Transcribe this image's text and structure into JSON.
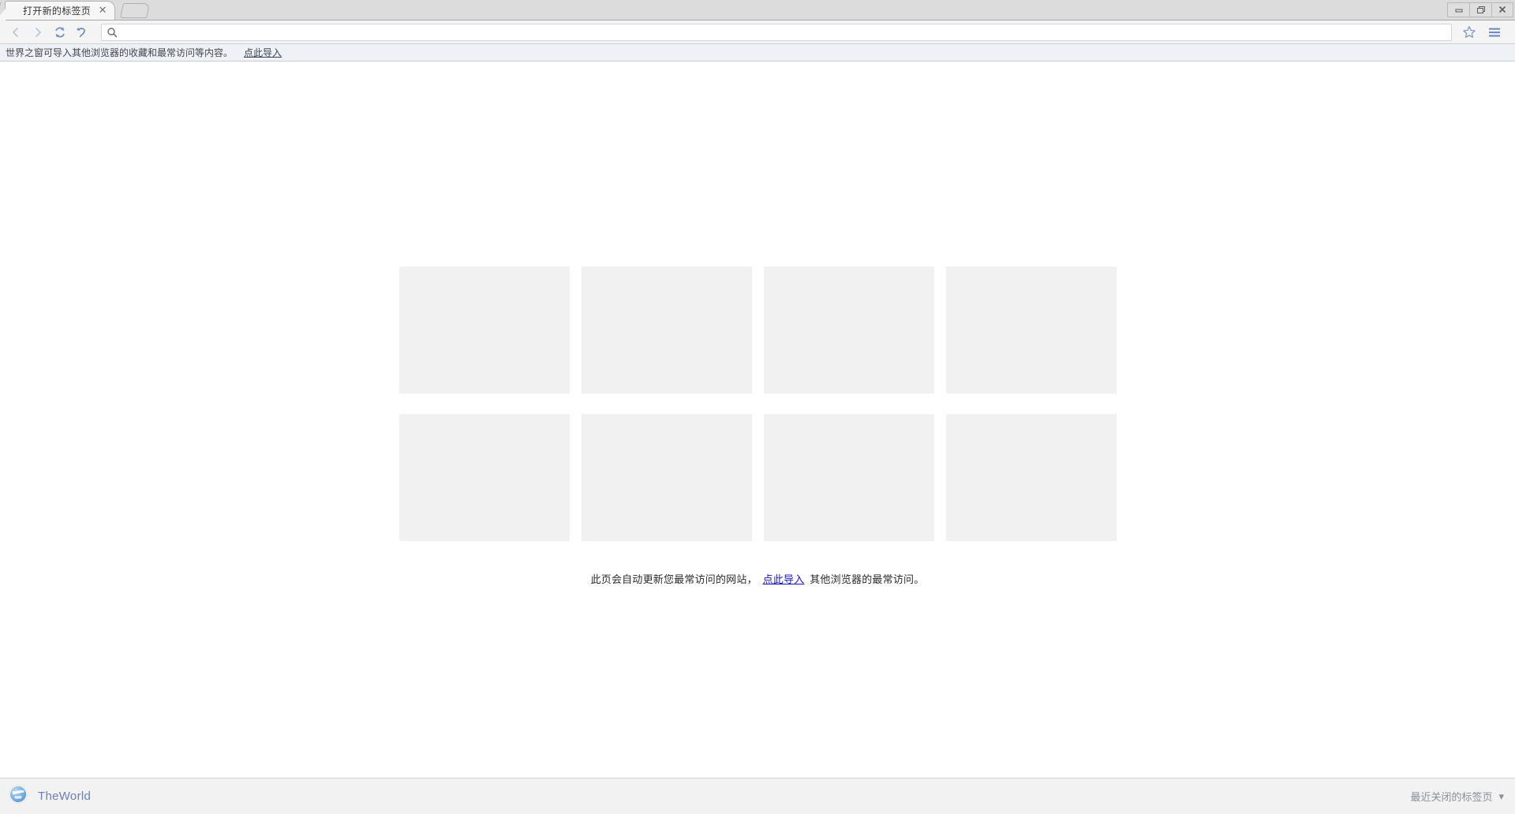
{
  "window": {
    "controls": [
      {
        "name": "minimize-button",
        "icon": "minimize-icon"
      },
      {
        "name": "restore-button",
        "icon": "restore-icon"
      },
      {
        "name": "close-button",
        "icon": "close-icon"
      }
    ]
  },
  "tabstrip": {
    "tabs": [
      {
        "title": "打开新的标签页",
        "close_label": "✕"
      }
    ],
    "new_tab_tooltip": "新建标签页"
  },
  "toolbar": {
    "back_label": "后退",
    "forward_label": "前进",
    "reload_label": "刷新",
    "undo_label": "撤销",
    "omnibox": {
      "value": "",
      "placeholder": ""
    },
    "bookmark_label": "收藏",
    "menu_label": "菜单"
  },
  "notification": {
    "text": "世界之窗可导入其他浏览器的收藏和最常访问等内容。",
    "link": "点此导入"
  },
  "content": {
    "thumbnails": [
      {
        "label": ""
      },
      {
        "label": ""
      },
      {
        "label": ""
      },
      {
        "label": ""
      },
      {
        "label": ""
      },
      {
        "label": ""
      },
      {
        "label": ""
      },
      {
        "label": ""
      }
    ],
    "hint_before": "此页会自动更新您最常访问的网站，",
    "hint_link": "点此导入",
    "hint_after": "其他浏览器的最常访问。"
  },
  "statusbar": {
    "brand": "TheWorld",
    "recent_tabs": "最近关闭的标签页",
    "chevron": "▾"
  },
  "colors": {
    "accent_blue": "#6c8cc4",
    "link_blue": "#1414cc",
    "thumb_gray": "#f1f1f1",
    "chrome_gray": "#dcdcdc",
    "notif_bg": "#eef1f5"
  }
}
